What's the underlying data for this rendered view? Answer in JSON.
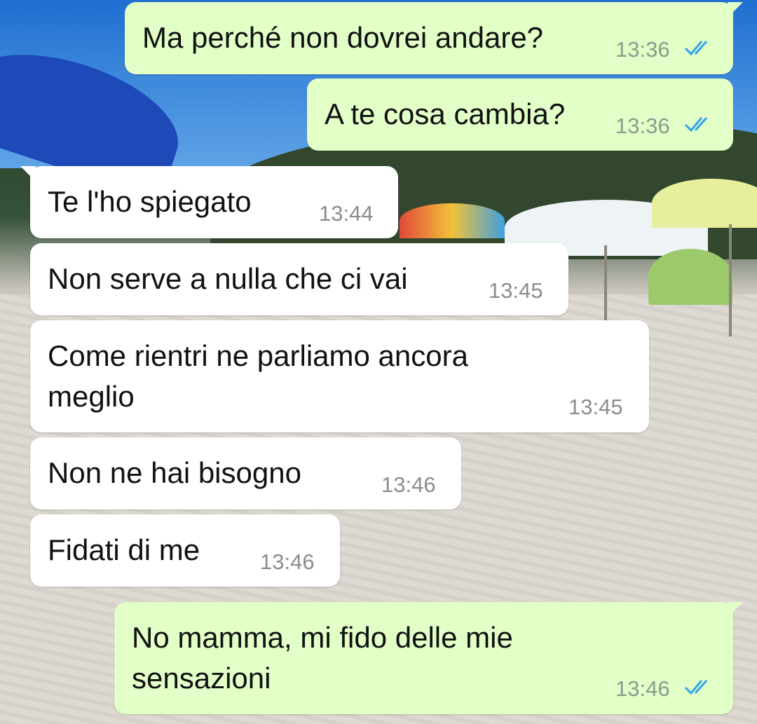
{
  "wallpaper": {
    "kind": "beach-photo",
    "colors": {
      "sky": "#1f6fd1",
      "sand": "#dcd8d1",
      "hill": "#33472f"
    }
  },
  "colors": {
    "outgoing_bubble": "#e1ffc7",
    "incoming_bubble": "#ffffff",
    "read_ticks": "#34a3e8",
    "timestamp": "#8e9a8e"
  },
  "messages": [
    {
      "direction": "out",
      "text": "Ma perché non dovrei andare?",
      "time": "13:36",
      "status_icon": "double-check-read-icon"
    },
    {
      "direction": "out",
      "text": "A te cosa cambia?",
      "time": "13:36",
      "status_icon": "double-check-read-icon"
    },
    {
      "direction": "in",
      "text": "Te l'ho spiegato",
      "time": "13:44"
    },
    {
      "direction": "in",
      "text": "Non serve a nulla che ci vai",
      "time": "13:45"
    },
    {
      "direction": "in",
      "text": "Come rientri ne parliamo ancora\nmeglio",
      "time": "13:45"
    },
    {
      "direction": "in",
      "text": "Non ne hai bisogno",
      "time": "13:46"
    },
    {
      "direction": "in",
      "text": "Fidati di me",
      "time": "13:46"
    },
    {
      "direction": "out",
      "text": "No mamma, mi fido delle mie\nsensazioni",
      "time": "13:46",
      "status_icon": "double-check-read-icon"
    }
  ]
}
